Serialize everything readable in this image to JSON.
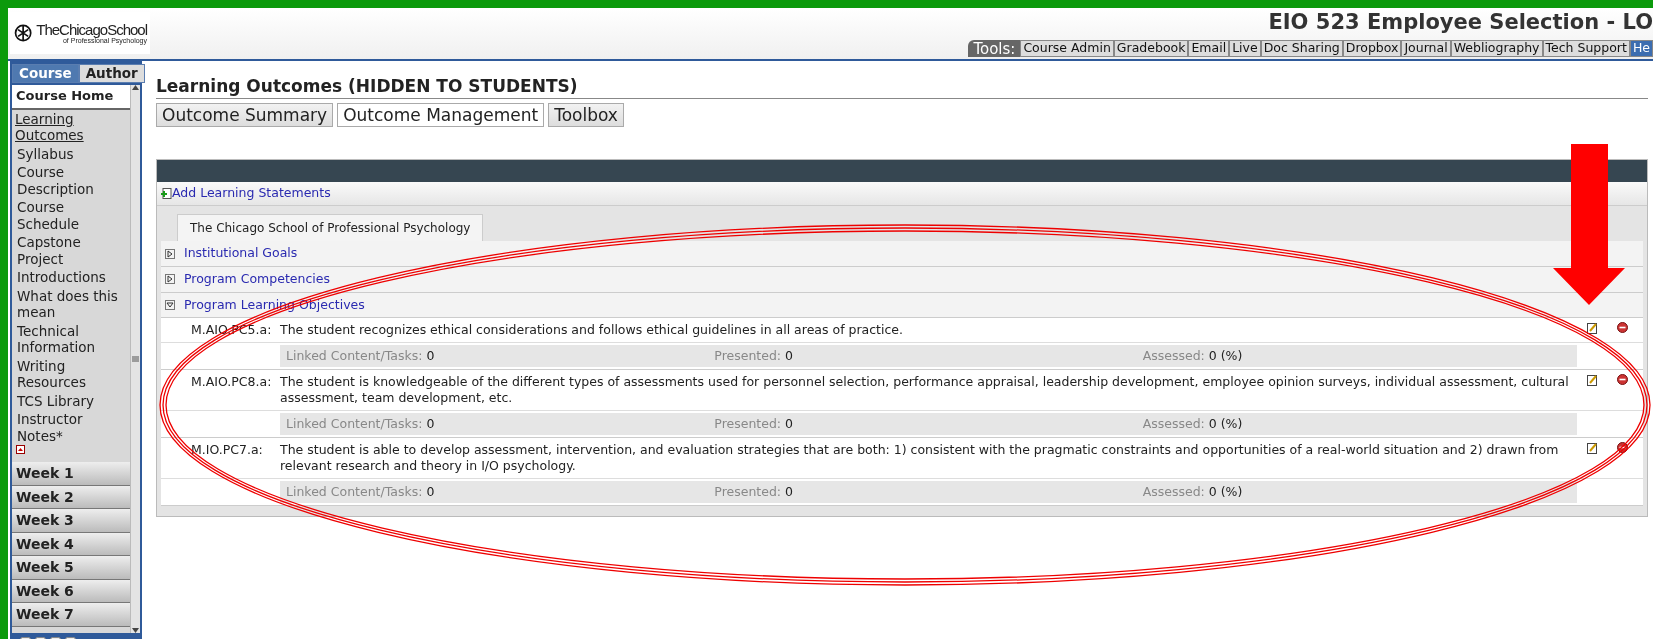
{
  "header": {
    "logo_text": "TheChicagoSchool",
    "logo_subtext": "of Professional Psychology",
    "course_title": "EIO 523 Employee Selection - LO",
    "tools_label": "Tools:",
    "tools": [
      {
        "label": "Course Admin",
        "selected": false
      },
      {
        "label": "Gradebook",
        "selected": false
      },
      {
        "label": "Email",
        "selected": false
      },
      {
        "label": "Live",
        "selected": false
      },
      {
        "label": "Doc Sharing",
        "selected": false
      },
      {
        "label": "Dropbox",
        "selected": false
      },
      {
        "label": "Journal",
        "selected": false
      },
      {
        "label": "Webliography",
        "selected": false
      },
      {
        "label": "Tech Support",
        "selected": false
      },
      {
        "label": "He",
        "selected": true
      }
    ]
  },
  "sidebar": {
    "tabs": [
      {
        "label": "Course",
        "selected": true
      },
      {
        "label": "Author",
        "selected": false
      }
    ],
    "items": [
      {
        "label": "Course Home",
        "kind": "heading"
      },
      {
        "label": "Learning Outcomes",
        "kind": "current"
      },
      {
        "label": "Syllabus",
        "kind": "link"
      },
      {
        "label": "Course Description",
        "kind": "link"
      },
      {
        "label": "Course Schedule",
        "kind": "link"
      },
      {
        "label": "Capstone Project",
        "kind": "link"
      },
      {
        "label": "Introductions",
        "kind": "link"
      },
      {
        "label": "What does this mean",
        "kind": "link"
      },
      {
        "label": "Technical Information",
        "kind": "link"
      },
      {
        "label": "Writing Resources",
        "kind": "link"
      },
      {
        "label": "TCS Library",
        "kind": "link"
      },
      {
        "label": "Instructor Notes*",
        "kind": "link"
      }
    ],
    "weeks": [
      "Week 1",
      "Week 2",
      "Week 3",
      "Week 4",
      "Week 5",
      "Week 6",
      "Week 7"
    ]
  },
  "page": {
    "title": "Learning Outcomes (HIDDEN TO STUDENTS)",
    "tabs": [
      {
        "label": "Outcome Summary",
        "selected": false
      },
      {
        "label": "Outcome Management",
        "selected": true
      },
      {
        "label": "Toolbox",
        "selected": false
      }
    ],
    "add_link": "Add Learning Statements",
    "org_tab": "The Chicago School of Professional Psychology",
    "categories": [
      {
        "label": "Institutional Goals",
        "expanded": false
      },
      {
        "label": "Program Competencies",
        "expanded": false
      },
      {
        "label": "Program Learning Objectives",
        "expanded": true
      }
    ],
    "outcomes": [
      {
        "code": "M.AIO.PC5.a:",
        "text": "The student recognizes ethical considerations and follows ethical guidelines in all areas of practice.",
        "stats": [
          {
            "label": "Linked Content/Tasks:",
            "value": "0"
          },
          {
            "label": "Presented:",
            "value": "0"
          },
          {
            "label": "Assessed:",
            "value": "0 (%)"
          }
        ]
      },
      {
        "code": "M.AIO.PC8.a:",
        "text": "The student is knowledgeable of the different types of assessments used for personnel selection, performance appraisal, leadership development, employee opinion surveys, individual assessment, cultural assessment, team development, etc.",
        "stats": [
          {
            "label": "Linked Content/Tasks:",
            "value": "0"
          },
          {
            "label": "Presented:",
            "value": "0"
          },
          {
            "label": "Assessed:",
            "value": "0 (%)"
          }
        ]
      },
      {
        "code": "M.IO.PC7.a:",
        "text": "The student is able to develop assessment, intervention, and evaluation strategies that are both: 1) consistent with the pragmatic constraints and opportunities of a real-world situation and 2) drawn from relevant research and theory in I/O psychology.",
        "stats": [
          {
            "label": "Linked Content/Tasks:",
            "value": "0"
          },
          {
            "label": "Presented:",
            "value": "0"
          },
          {
            "label": "Assessed:",
            "value": "0 (%)"
          }
        ]
      }
    ]
  }
}
